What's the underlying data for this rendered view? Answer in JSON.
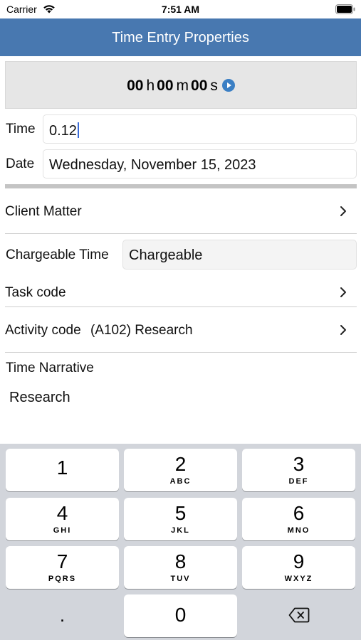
{
  "status": {
    "carrier": "Carrier",
    "time": "7:51 AM"
  },
  "nav": {
    "title": "Time Entry Properties"
  },
  "timer": {
    "hours": "00",
    "h": "h",
    "minutes": "00",
    "m": "m",
    "seconds": "00",
    "s": "s"
  },
  "time_field": {
    "label": "Time",
    "value": "0.12"
  },
  "date_field": {
    "label": "Date",
    "value": "Wednesday, November 15, 2023"
  },
  "client_matter": {
    "label": "Client Matter"
  },
  "chargeable": {
    "label": "Chargeable Time",
    "value": "Chargeable"
  },
  "task_code": {
    "label": "Task code"
  },
  "activity_code": {
    "label": "Activity code",
    "value": "(A102) Research"
  },
  "narrative": {
    "label": "Time Narrative",
    "value": "Research"
  },
  "keypad": {
    "k1": {
      "digit": "1",
      "letters": ""
    },
    "k2": {
      "digit": "2",
      "letters": "ABC"
    },
    "k3": {
      "digit": "3",
      "letters": "DEF"
    },
    "k4": {
      "digit": "4",
      "letters": "GHI"
    },
    "k5": {
      "digit": "5",
      "letters": "JKL"
    },
    "k6": {
      "digit": "6",
      "letters": "MNO"
    },
    "k7": {
      "digit": "7",
      "letters": "PQRS"
    },
    "k8": {
      "digit": "8",
      "letters": "TUV"
    },
    "k9": {
      "digit": "9",
      "letters": "WXYZ"
    },
    "k0": {
      "digit": "0"
    },
    "decimal": "."
  },
  "icons": {
    "wifi": "wifi-icon",
    "battery": "battery-icon",
    "play": "play-icon",
    "chevron": "chevron-right-icon",
    "delete": "backspace-icon"
  },
  "colors": {
    "nav": "#4878b0",
    "accent": "#3a6bd8",
    "keyboard": "#d2d5db"
  }
}
